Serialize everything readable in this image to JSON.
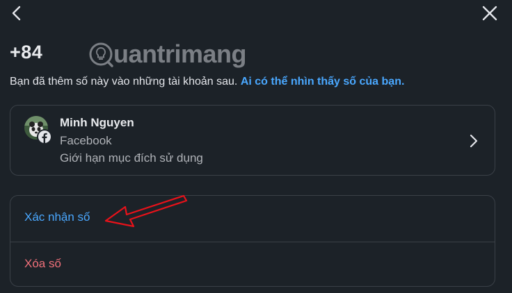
{
  "header": {
    "back_icon": "chevron-left-icon",
    "close_icon": "close-icon"
  },
  "phone": {
    "number": "+84"
  },
  "watermark": {
    "text": "uantrimang",
    "icon": "lightbulb-logo"
  },
  "description": {
    "text": "Bạn đã thêm số này vào những tài khoản sau.",
    "link_text": "Ai có thể nhìn thấy số của bạn."
  },
  "account": {
    "name": "Minh Nguyen",
    "platform": "Facebook",
    "limitation": "Giới hạn mục đích sử dụng",
    "badge_icon": "facebook-icon",
    "chevron_icon": "chevron-right-icon"
  },
  "actions": {
    "verify_label": "Xác nhận số",
    "delete_label": "Xóa số"
  },
  "colors": {
    "background": "#1c2228",
    "link": "#4aa8ff",
    "danger": "#f0707a",
    "border": "#3b4148",
    "annotation": "#e8121a"
  }
}
